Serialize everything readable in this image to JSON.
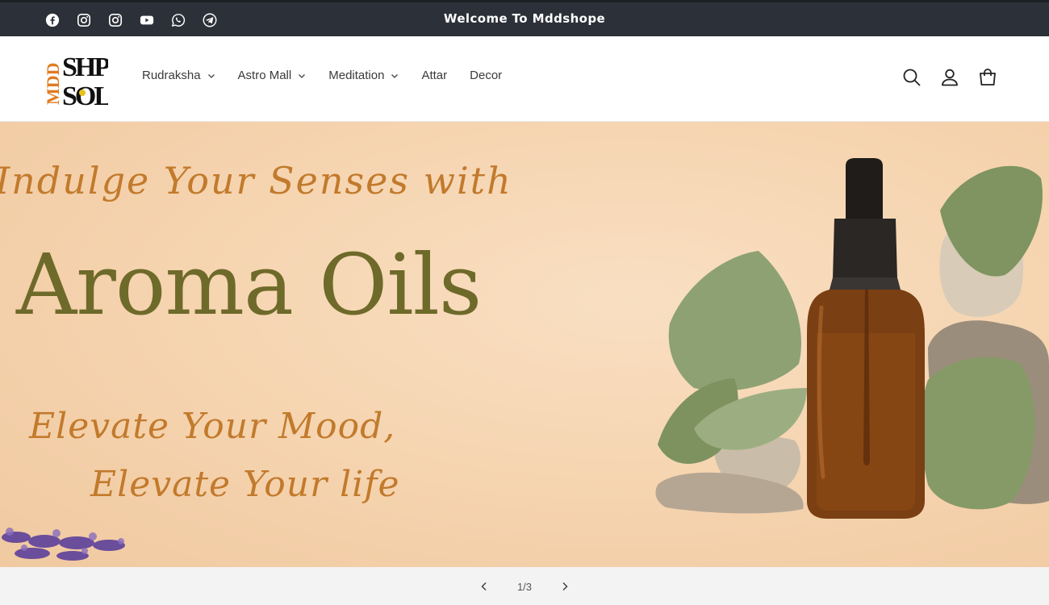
{
  "announcement": {
    "text": "Welcome To Mddshope",
    "socials": [
      "facebook-icon",
      "instagram-icon",
      "instagram-icon",
      "youtube-icon",
      "whatsapp-icon",
      "telegram-icon"
    ]
  },
  "header": {
    "logo": {
      "text": "MDD SHOPE"
    },
    "nav": [
      {
        "label": "Rudraksha",
        "dropdown": true
      },
      {
        "label": "Astro Mall",
        "dropdown": true
      },
      {
        "label": "Meditation",
        "dropdown": true
      },
      {
        "label": "Attar",
        "dropdown": false
      },
      {
        "label": "Decor",
        "dropdown": false
      }
    ],
    "icons": [
      "search-icon",
      "account-icon",
      "cart-icon"
    ]
  },
  "hero": {
    "line1": "Indulge Your Senses with",
    "title": "Aroma Oils",
    "line3": "Elevate Your Mood,",
    "line4": "Elevate Your life"
  },
  "slider": {
    "counter": "1/3",
    "prev_icon": "chevron-left-icon",
    "next_icon": "chevron-right-icon"
  },
  "colors": {
    "topbar": "#2c3038",
    "hero_bg": "#f5d3ae",
    "script_text": "#c27a2c",
    "title_text": "#6e6a2a",
    "logo_accent": "#e07b22"
  }
}
